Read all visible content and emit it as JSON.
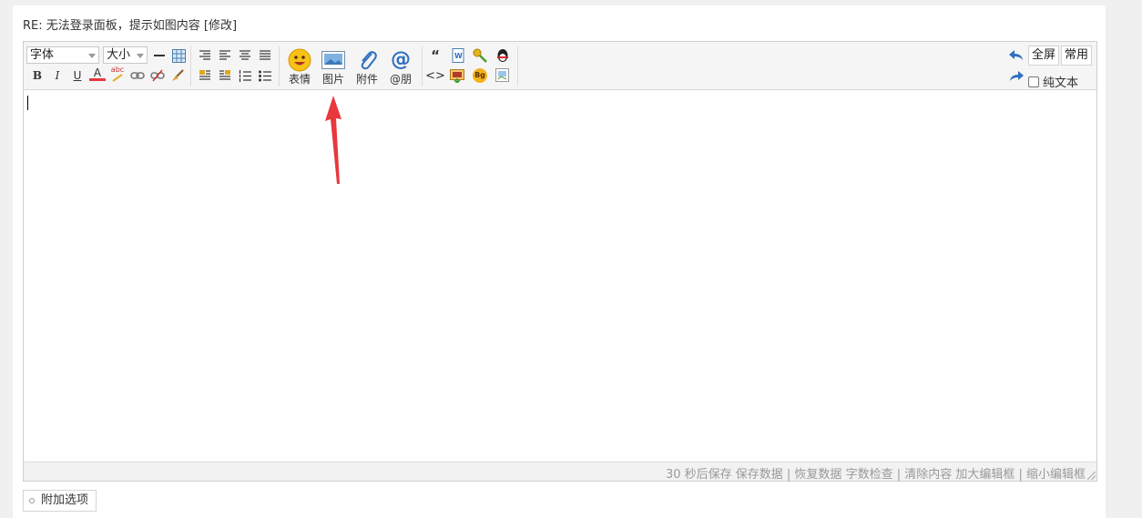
{
  "reply_title": "RE: 无法登录面板，提示如图内容 [修改]",
  "toolbar": {
    "font_select": "字体",
    "size_select": "大小",
    "bold": "B",
    "italic": "I",
    "underline": "U",
    "font_color": "A",
    "spellcheck": "abc",
    "quote_glyph": "“",
    "code_glyph": "<>",
    "bg_badge": "Bg",
    "emoji_label": "表情",
    "image_label": "图片",
    "attach_label": "附件",
    "at_symbol": "@",
    "at_label": "@朋",
    "fullscreen_label": "全屏",
    "common_label": "常用",
    "plaintext_label": "纯文本"
  },
  "status_bar": {
    "text": "30 秒后保存 保存数据 | 恢复数据    字数检查 | 清除内容    加大编辑框 | 缩小编辑框"
  },
  "addon": {
    "label": "附加选项"
  },
  "colors": {
    "annotation_arrow": "#e8383d",
    "accent_blue": "#2f6fc0"
  }
}
